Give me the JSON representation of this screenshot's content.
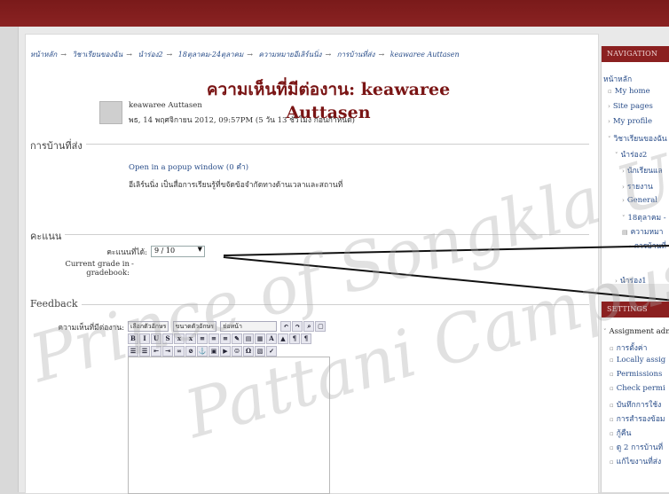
{
  "breadcrumb": [
    "หน้าหลัก",
    "วิชาเรียนของฉัน",
    "นำร่อง2",
    "18ตุลาคม-24ตุลาคม",
    "ความหมายอีเลิร์นนิ่ง",
    "การบ้านที่ส่ง",
    "keawaree Auttasen"
  ],
  "page_title": "ความเห็นที่มีต่องาน: keawaree Auttasen",
  "author": "keawaree Auttasen",
  "date": "พธ, 14 พฤศจิกายน 2012, 09:57PM (5 วัน 13 ชั่วโมง ก่อนกำหนด)",
  "submission": {
    "legend": "การบ้านที่ส่ง",
    "link": "Open in a popup window (0 คำ)",
    "text": "อีเลิร์นนิ่ง เป็นสื่อการเรียนรู้ที่ขจัดข้อจำกัดทางด้านเวลาและสถานที่"
  },
  "grade": {
    "legend": "คะแนน",
    "label": "คะแนนที่ได้:",
    "value": "9 / 10",
    "current_label": "Current grade in gradebook:",
    "current_value": "-"
  },
  "feedback": {
    "legend": "Feedback",
    "label": "ความเห็นที่มีต่องาน:",
    "font_family": "เลือกตัวอักษร",
    "font_size": "ขนาดตัวอักษร",
    "format": "ย่อหน้า"
  },
  "navigation": {
    "header": "NAVIGATION",
    "items": [
      "หน้าหลัก",
      "My home",
      "Site pages",
      "My profile",
      "วิชาเรียนของฉัน",
      "นำร่อง2",
      "นักเรียนแล",
      "รายงาน",
      "General",
      "18ตุลาคม -",
      "ความหมา",
      "การบ้านที่",
      "นำร่อง1"
    ]
  },
  "settings": {
    "header": "SETTINGS",
    "items": [
      "Assignment adm",
      "การตั้งค่า",
      "Locally assig",
      "Permissions",
      "Check permi",
      "บันทึกการใช้ง",
      "การสำรองข้อม",
      "กู้คืน",
      "ดู 2 การบ้านที่",
      "แก้ไขงานที่ส่ง"
    ]
  },
  "watermark": {
    "line1": "Prince of Songkla Univ",
    "line2": "Pattani Campus"
  }
}
